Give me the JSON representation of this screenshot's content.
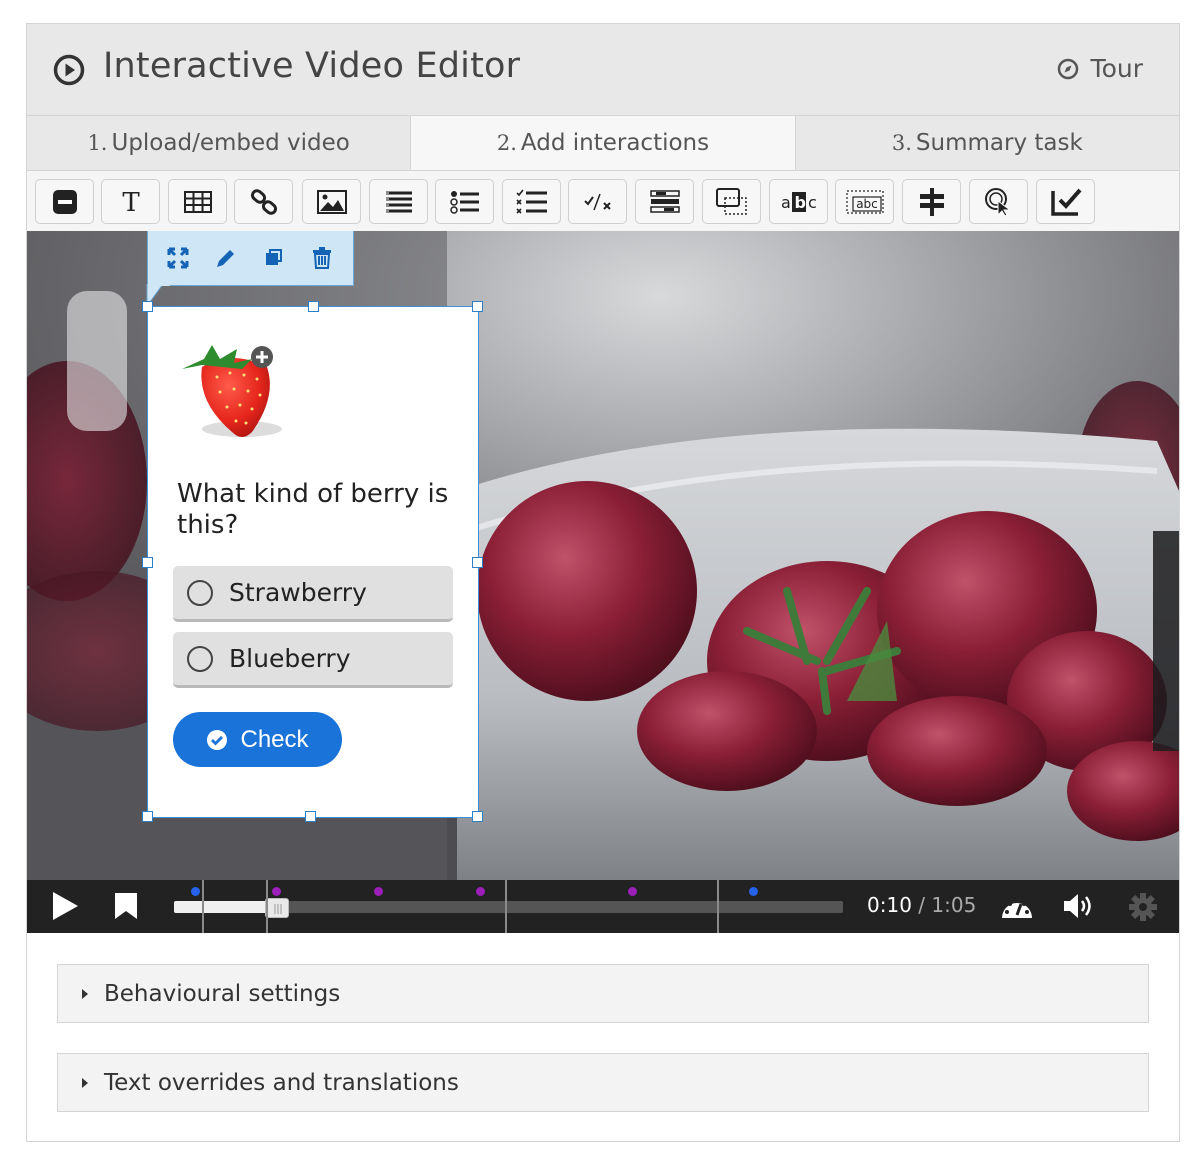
{
  "header": {
    "title": "Interactive Video Editor",
    "tour_label": "Tour",
    "logo_icon": "play-circle-icon",
    "tour_icon": "compass-icon"
  },
  "tabs": [
    {
      "number": "1.",
      "label": "Upload/embed video",
      "active": false
    },
    {
      "number": "2.",
      "label": "Add interactions",
      "active": true
    },
    {
      "number": "3.",
      "label": "Summary task",
      "active": false
    }
  ],
  "toolbar": {
    "tools": [
      "label-icon",
      "text-icon",
      "table-icon",
      "link-icon",
      "image-icon",
      "statements-icon",
      "single-choice-set-icon",
      "multiple-choice-icon",
      "true-false-icon",
      "drag-and-drop-icon",
      "drag-text-icon",
      "mark-the-words-icon",
      "fill-in-the-blanks-icon",
      "crossroads-icon",
      "navigation-hotspot-icon",
      "free-text-question-icon"
    ]
  },
  "popup_toolbar": {
    "tools": [
      "fullscreen-icon",
      "edit-icon",
      "bring-to-front-icon",
      "delete-icon"
    ]
  },
  "interaction": {
    "question": "What kind of berry is this?",
    "answers": [
      "Strawberry",
      "Blueberry"
    ],
    "check_label": "Check",
    "image": "strawberry-image"
  },
  "player": {
    "current_time": "0:10",
    "separator": " / ",
    "total_time": "1:05",
    "progress_fraction": 0.154,
    "interaction_markers": [
      {
        "time_fraction": 0.031,
        "color": "#2563eb"
      },
      {
        "time_fraction": 0.153,
        "color": "#9b1fb8"
      },
      {
        "time_fraction": 0.305,
        "color": "#9b1fb8"
      },
      {
        "time_fraction": 0.457,
        "color": "#9b1fb8"
      },
      {
        "time_fraction": 0.684,
        "color": "#9b1fb8"
      },
      {
        "time_fraction": 0.866,
        "color": "#2563eb"
      }
    ],
    "bookmark_fractions": [
      0.042,
      0.137,
      0.495,
      0.812
    ]
  },
  "sections": [
    {
      "label": "Behavioural settings"
    },
    {
      "label": "Text overrides and translations"
    }
  ],
  "colors": {
    "accent": "#1a73d9",
    "selection": "#3d8fd6",
    "header_bg": "#e8e8e8",
    "player_bg": "#222222"
  }
}
